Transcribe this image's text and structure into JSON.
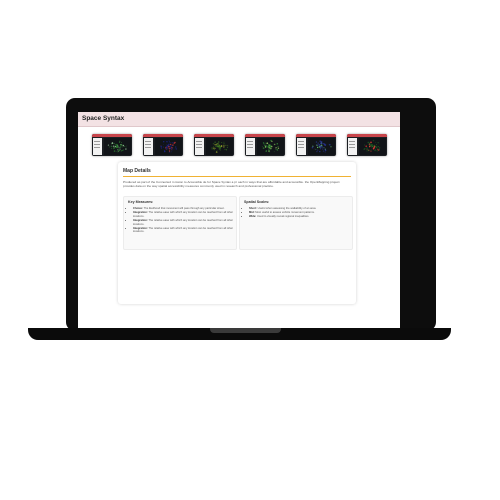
{
  "app": {
    "title": "Space Syntax"
  },
  "thumbnails": [
    {
      "label": "map-1",
      "map_color": "#2e7d32",
      "glow": "#a5d6a7"
    },
    {
      "label": "map-2",
      "map_color": "#1a237e",
      "glow": "#e53935"
    },
    {
      "label": "map-3",
      "map_color": "#33691e",
      "glow": "#c0ca33"
    },
    {
      "label": "map-4",
      "map_color": "#2e7d32",
      "glow": "#9ccc65"
    },
    {
      "label": "map-5",
      "map_color": "#283593",
      "glow": "#66bb6a"
    },
    {
      "label": "map-6",
      "map_color": "#1b5e20",
      "glow": "#e53935"
    }
  ],
  "details": {
    "title": "Map Details",
    "intro": "Produced as part of the Connected m ission to Accessible de for Space Syntax a pr oach in ways that are affordable and accessible. the OpenMapping project provides data on the way spatial accessibility measures commonly used in research and professional practice.",
    "key_measures": {
      "title": "Key Measures:",
      "items": [
        {
          "term": "Choice:",
          "text": "The likelihood that movement will pass through any particular street."
        },
        {
          "term": "Integration:",
          "text": "The relative ease with which any location can be reached from all other locations."
        },
        {
          "term": "Integration:",
          "text": "The relative ease with which any location can be reached from all other locations."
        },
        {
          "term": "Integration:",
          "text": "The relative ease with which any location can be reached from all other locations."
        }
      ]
    },
    "spatial_scales": {
      "title": "Spatial Scales:",
      "items": [
        {
          "term": "Short:",
          "text": "Useful when assessing the walkability of an area."
        },
        {
          "term": "Mid:",
          "text": "Most useful to assess vehicle movement patterns."
        },
        {
          "term": "Wide:",
          "text": "Used to visually reveal regional inequalities."
        }
      ]
    }
  }
}
